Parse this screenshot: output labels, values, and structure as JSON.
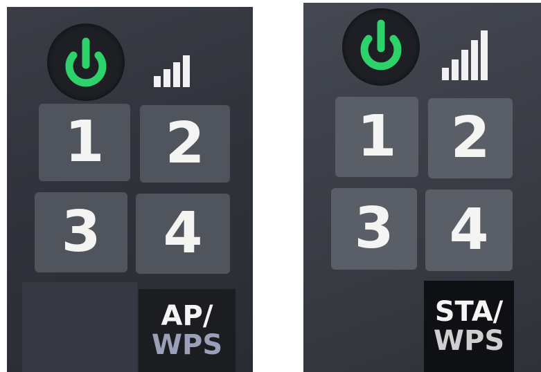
{
  "left_panel": {
    "keys": [
      "1",
      "2",
      "3",
      "4"
    ],
    "mode_label_top": "AP/",
    "mode_label_bottom": "WPS"
  },
  "right_panel": {
    "keys": [
      "1",
      "2",
      "3",
      "4"
    ],
    "mode_label_top": "STA/",
    "mode_label_bottom": "WPS"
  },
  "icons": {
    "power": "power-icon",
    "signal": "signal-bars-icon"
  },
  "colors": {
    "power_green": "#2ed26a",
    "panel_dark": "#30333b",
    "key_face": "#50545c",
    "digit": "#f4f4f2",
    "wps_left": "#9aa0b8",
    "wps_right": "#cfcfcf"
  }
}
